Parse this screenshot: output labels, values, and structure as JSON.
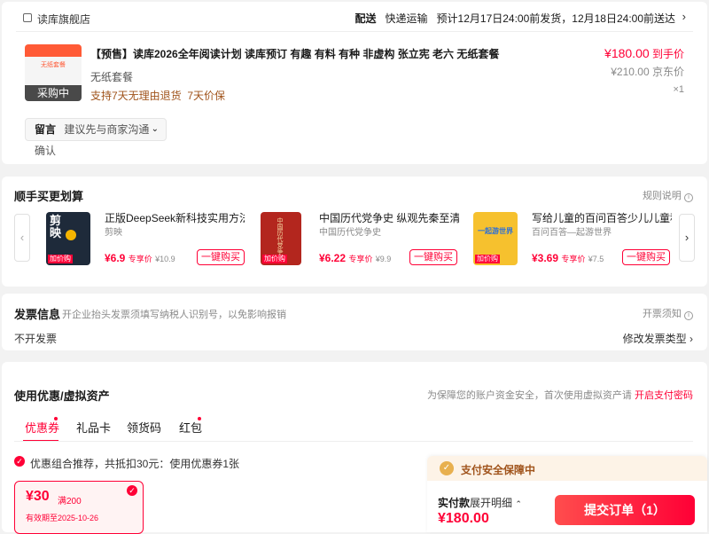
{
  "shop": {
    "name": "读库旗舰店",
    "delivery_label": "配送",
    "delivery_method": "快递运输",
    "delivery_estimate": "预计12月17日24:00前发货，12月18日24:00前送达"
  },
  "item": {
    "badge": "采购中",
    "title": "【预售】读库2026全年阅读计划 读库预订 有趣 有料 有种 非虚构 张立宪 老六 无纸套餐",
    "sku": "无纸套餐",
    "service": "支持7天无理由退货  7天价保",
    "price": "¥180.00",
    "price_note": "到手价",
    "orig_price": "¥210.00",
    "orig_note": "京东价",
    "qty": "×1",
    "thumb_text": "无纸套餐"
  },
  "note": {
    "label": "留言",
    "placeholder": "建议先与商家沟通确认"
  },
  "addon": {
    "title": "顺手买更划算",
    "rules": "规则说明",
    "products": [
      {
        "title": "正版DeepSeek新科技实用方法 零",
        "sub": "剪映",
        "price": "¥6.9",
        "tag": "专享价",
        "ref": "¥10.9",
        "btn": "一键购买",
        "ribbon": "加价购",
        "cover_text": "剪映"
      },
      {
        "title": "中国历代党争史 纵观先秦至清末的",
        "sub": "中国历代党争史",
        "price": "¥6.22",
        "tag": "专享价",
        "ref": "¥9.9",
        "btn": "一键购买",
        "ribbon": "加价购",
        "cover_text": "中国历代党争史"
      },
      {
        "title": "写给儿童的百问百答少儿儿童科普",
        "sub": "百问百答—起游世界",
        "price": "¥3.69",
        "tag": "专享价",
        "ref": "¥7.5",
        "btn": "一键购买",
        "ribbon": "加价购",
        "cover_text": "一起游世界"
      }
    ]
  },
  "invoice": {
    "title": "发票信息",
    "hint": "开企业抬头发票须填写纳税人识别号，以免影响报销",
    "notice": "开票须知",
    "value": "不开发票",
    "modify": "修改发票类型"
  },
  "assets": {
    "title": "使用优惠/虚拟资产",
    "security_note": "为保障您的账户资金安全，首次使用虚拟资产请",
    "security_link": "开启支付密码",
    "tabs": [
      "优惠券",
      "礼品卡",
      "领货码",
      "红包"
    ],
    "recommend": "优惠组合推荐，共抵扣30元：使用优惠券1张",
    "coupon": {
      "amount": "¥30",
      "cond": "满200",
      "expiry": "有效期至2025-10-26"
    }
  },
  "pay": {
    "guarantee": "支付安全保障中",
    "label": "实付款",
    "detail": "展开明细",
    "amount": "¥180.00",
    "submit": "提交订单（1）"
  },
  "colors": {
    "accent": "#ff0036",
    "orange": "#ff5000",
    "brown": "#a0531b"
  }
}
